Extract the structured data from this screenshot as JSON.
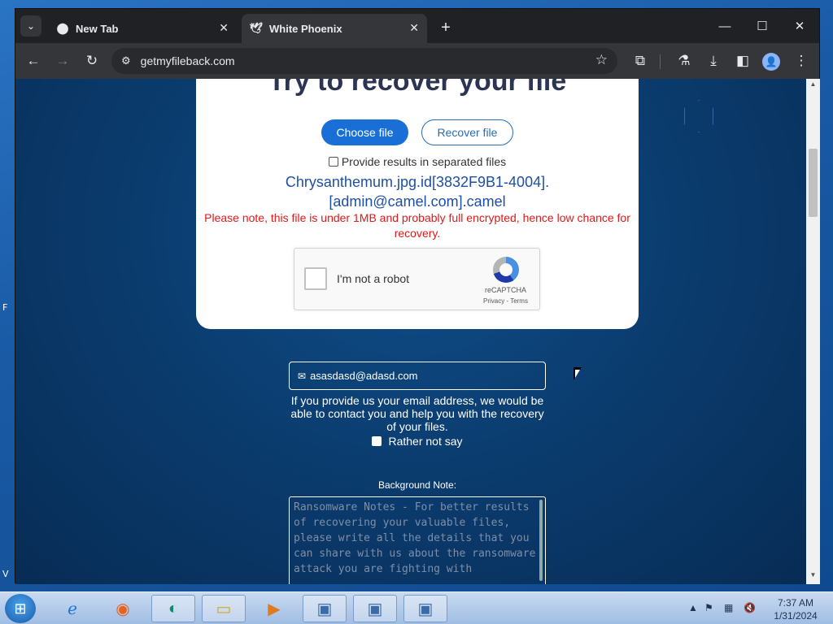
{
  "browser": {
    "tabs": [
      {
        "title": "New Tab",
        "favicon": "chrome-logo-icon",
        "active": false
      },
      {
        "title": "White Phoenix",
        "favicon": "phoenix-icon",
        "active": true
      }
    ],
    "url": "getmyfileback.com"
  },
  "page": {
    "title": "Try to recover your file",
    "choose_file_label": "Choose file",
    "recover_file_label": "Recover file",
    "separate_results_label": "Provide results in separated files",
    "filename_line1": "Chrysanthemum.jpg.id[3832F9B1-4004].",
    "filename_line2": "[admin@camel.com].camel",
    "warning": "Please note, this file is under 1MB and probably full encrypted, hence low chance for recovery.",
    "captcha": {
      "label": "I'm not a robot",
      "brand": "reCAPTCHA",
      "links": "Privacy - Terms"
    },
    "email_value": "asasdasd@adasd.com",
    "email_help": "If you provide us your email address, we would be able to contact you and help you with the recovery of your files.",
    "rather_not_say_label": "Rather not say",
    "background_note_label": "Background Note:",
    "notes_placeholder": "Ransomware Notes - For better results of recovering your valuable files, please write all the details that you can share with us about the ransomware attack you are fighting with"
  },
  "taskbar": {
    "time": "7:37 AM",
    "date": "1/31/2024"
  }
}
